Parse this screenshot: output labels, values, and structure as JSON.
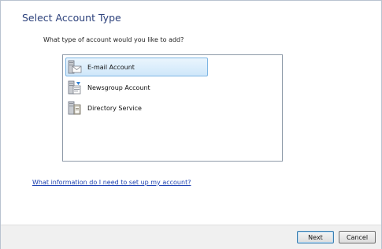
{
  "dialog": {
    "heading": "Select Account Type",
    "prompt": "What type of account would you like to add?"
  },
  "account_types": [
    {
      "label": "E-mail Account",
      "icon": "email-account-icon",
      "selected": true
    },
    {
      "label": "Newsgroup Account",
      "icon": "newsgroup-account-icon",
      "selected": false
    },
    {
      "label": "Directory Service",
      "icon": "directory-service-icon",
      "selected": false
    }
  ],
  "help_link": "What information do I need to set up my account?",
  "buttons": {
    "next": "Next",
    "cancel": "Cancel"
  },
  "colors": {
    "heading": "#2a3f7a",
    "link": "#1a3fb0",
    "selection": "#cfe7fa"
  }
}
